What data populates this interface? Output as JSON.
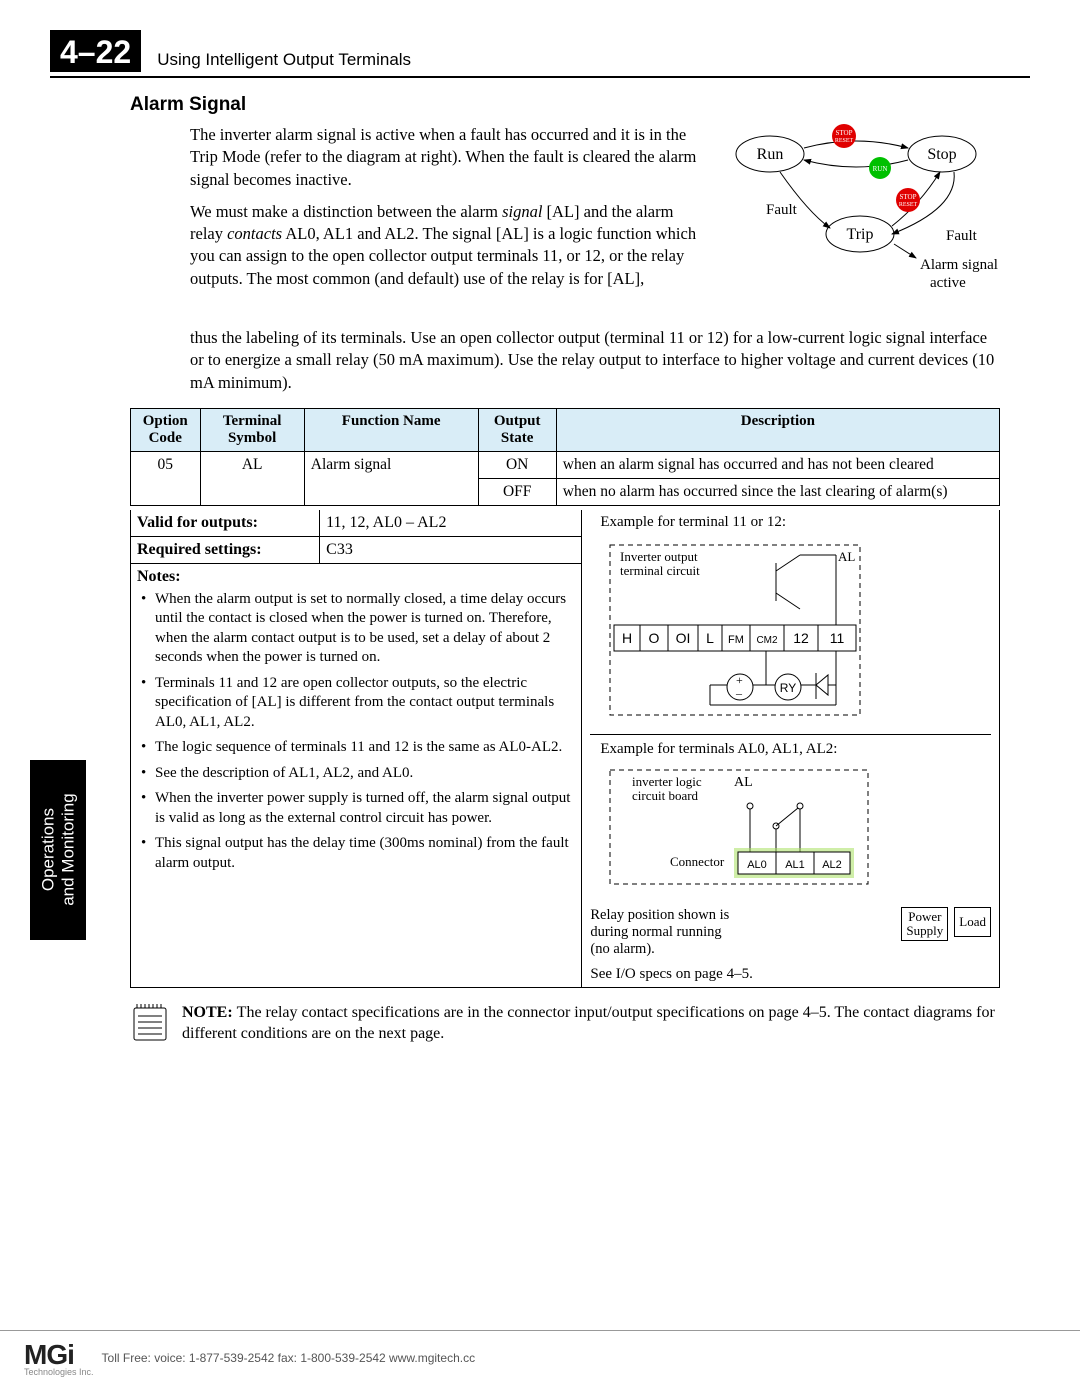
{
  "page_number": "4–22",
  "chapter_heading": "Using Intelligent Output Terminals",
  "side_tab_line1": "Operations",
  "side_tab_line2": "and Monitoring",
  "section_title": "Alarm Signal",
  "para1": "The inverter alarm signal is active when a fault has occurred and it is in the Trip Mode (refer to the diagram at right). When the fault is cleared the alarm signal becomes inactive.",
  "para2a": "We must make a distinction between the alarm ",
  "para2_em1": "signal",
  "para2b": " [AL] and the alarm relay ",
  "para2_em2": "contacts",
  "para2c": " AL0, AL1 and AL2. The signal [AL] is a logic function which you can assign to the open collector output terminals 11, or 12, or the relay outputs. The most common (and default) use of the relay is for [AL], thus the labeling of its terminals. Use an open collector output (terminal 11 or 12) for a low-current logic signal interface or to energize a small relay (50 mA maximum). Use the relay output to interface to higher voltage and current devices (10 mA minimum).",
  "state_diagram": {
    "run": "Run",
    "stop": "Stop",
    "trip": "Trip",
    "fault_l": "Fault",
    "fault_r": "Fault",
    "btn_stop_reset": "STOP\nRESET",
    "btn_run": "RUN",
    "alarm_active_l1": "Alarm signal",
    "alarm_active_l2": "active"
  },
  "table": {
    "headers": {
      "c1": "Option Code",
      "c2": "Terminal Symbol",
      "c3": "Function Name",
      "c4": "Output State",
      "c5": "Description"
    },
    "row1": {
      "code": "05",
      "sym": "AL",
      "fn": "Alarm signal",
      "state": "ON",
      "desc": "when an alarm signal has occurred and has not been cleared"
    },
    "row2": {
      "state": "OFF",
      "desc": "when no alarm has occurred since the last clearing of alarm(s)"
    }
  },
  "valid_outputs_label": "Valid for outputs:",
  "valid_outputs_value": "11, 12, AL0 – AL2",
  "required_settings_label": "Required settings:",
  "required_settings_value": "C33",
  "notes_label": "Notes:",
  "notes": {
    "n1": "When the alarm output is set to normally closed, a time delay occurs until the contact is closed when the power is turned on.  Therefore, when the alarm contact output is to be used, set a delay of about 2 seconds when the power is turned on.",
    "n2": "Terminals 11 and 12 are open collector outputs, so the electric specification of [AL] is different from the contact output terminals AL0, AL1, AL2.",
    "n3": "The logic sequence of terminals 11 and 12 is the same as AL0-AL2.",
    "n4": "See the description of AL1, AL2, and AL0.",
    "n5": "When the inverter power supply is turned off, the alarm signal output is valid as long as the external control circuit has power.",
    "n6": "This signal output has the delay time (300ms nominal) from the fault alarm output."
  },
  "example1_title": "Example for terminal 11 or 12:",
  "circuit1": {
    "label1": "Inverter output",
    "label2": "terminal circuit",
    "AL": "AL",
    "H": "H",
    "O": "O",
    "OI": "OI",
    "L": "L",
    "FM": "FM",
    "CM2": "CM2",
    "t12": "12",
    "t11": "11",
    "RY": "RY",
    "plus": "+",
    "minus": "–"
  },
  "example2_title": "Example for terminals AL0, AL1, AL2:",
  "circuit2": {
    "label1": "inverter logic",
    "label2": "circuit board",
    "AL": "AL",
    "connector": "Connector",
    "al0": "AL0",
    "al1": "AL1",
    "al2": "AL2",
    "relay_note_l1": "Relay position shown is",
    "relay_note_l2": "during normal running",
    "relay_note_l3": "(no alarm).",
    "power": "Power",
    "supply": "Supply",
    "load": "Load",
    "io_spec": "See I/O specs on page 4–5."
  },
  "note_block_prefix": "NOTE: ",
  "note_block_text": "The relay contact specifications are in the connector input/output specifications on page 4–5. The contact diagrams for different conditions are on the next page.",
  "footer": {
    "logo": "MGi",
    "logo_sub": "Technologies Inc.",
    "contact": "Toll Free:   voice: 1-877-539-2542   fax: 1-800-539-2542   www.mgitech.cc"
  }
}
